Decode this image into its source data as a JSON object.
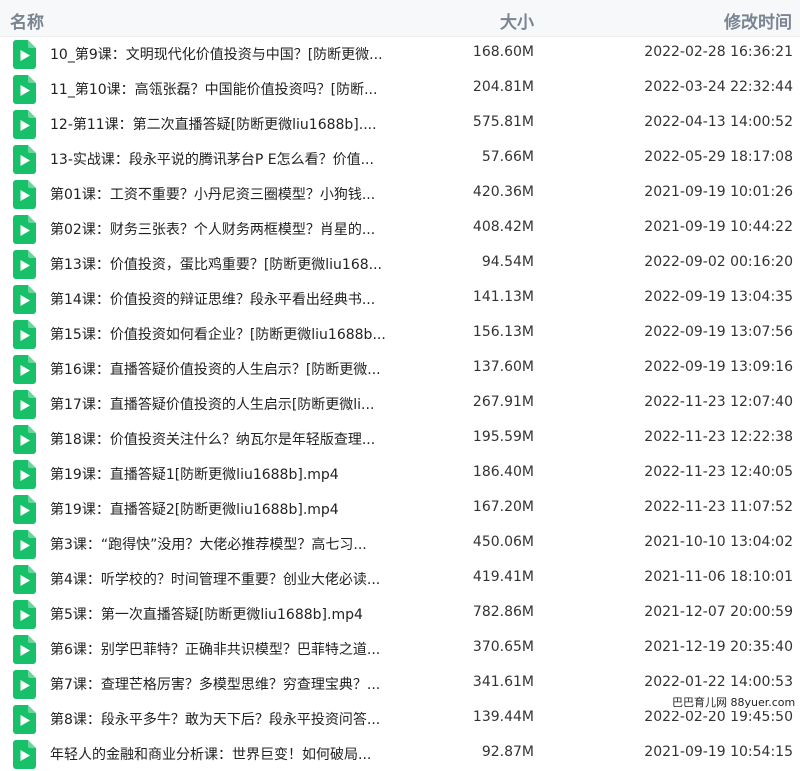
{
  "header": {
    "name": "名称",
    "size": "大小",
    "modified": "修改时间"
  },
  "icon_color": "#19c06a",
  "files": [
    {
      "name": "10_第9课：文明现代化价值投资与中国？[防断更微...",
      "size": "168.60M",
      "modified": "2022-02-28 16:36:21"
    },
    {
      "name": "11_第10课：高瓴张磊？中国能价值投资吗？[防断...",
      "size": "204.81M",
      "modified": "2022-03-24 22:32:44"
    },
    {
      "name": "12-第11课：第二次直播答疑[防断更微liu1688b]....",
      "size": "575.81M",
      "modified": "2022-04-13 14:00:52"
    },
    {
      "name": "13-实战课：段永平说的腾讯茅台P E怎么看？价值...",
      "size": "57.66M",
      "modified": "2022-05-29 18:17:08"
    },
    {
      "name": "第01课：工资不重要？小丹尼资三圈模型？小狗钱...",
      "size": "420.36M",
      "modified": "2021-09-19 10:01:26"
    },
    {
      "name": "第02课：财务三张表？个人财务两框模型？肖星的...",
      "size": "408.42M",
      "modified": "2021-09-19 10:44:22"
    },
    {
      "name": "第13课：价值投资，蛋比鸡重要？[防断更微liu168...",
      "size": "94.54M",
      "modified": "2022-09-02 00:16:20"
    },
    {
      "name": "第14课：价值投资的辩证思维？段永平看出经典书...",
      "size": "141.13M",
      "modified": "2022-09-19 13:04:35"
    },
    {
      "name": "第15课：价值投资如何看企业？[防断更微liu1688b...",
      "size": "156.13M",
      "modified": "2022-09-19 13:07:56"
    },
    {
      "name": "第16课：直播答疑价值投资的人生启示？[防断更微...",
      "size": "137.60M",
      "modified": "2022-09-19 13:09:16"
    },
    {
      "name": "第17课：直播答疑价值投资的人生启示[防断更微li...",
      "size": "267.91M",
      "modified": "2022-11-23 12:07:40"
    },
    {
      "name": "第18课：价值投资关注什么？纳瓦尔是年轻版查理...",
      "size": "195.59M",
      "modified": "2022-11-23 12:22:38"
    },
    {
      "name": "第19课：直播答疑1[防断更微liu1688b].mp4",
      "size": "186.40M",
      "modified": "2022-11-23 12:40:05"
    },
    {
      "name": "第19课：直播答疑2[防断更微liu1688b].mp4",
      "size": "167.20M",
      "modified": "2022-11-23 11:07:52"
    },
    {
      "name": "第3课：“跑得快”没用？大佬必推荐模型？高七习...",
      "size": "450.06M",
      "modified": "2021-10-10 13:04:02"
    },
    {
      "name": "第4课：听学校的？时间管理不重要？创业大佬必读...",
      "size": "419.41M",
      "modified": "2021-11-06 18:10:01"
    },
    {
      "name": "第5课：第一次直播答疑[防断更微liu1688b].mp4",
      "size": "782.86M",
      "modified": "2021-12-07 20:00:59"
    },
    {
      "name": "第6课：别学巴菲特？正确非共识模型？巴菲特之道...",
      "size": "370.65M",
      "modified": "2021-12-19 20:35:40"
    },
    {
      "name": "第7课：查理芒格厉害？多模型思维？穷查理宝典？...",
      "size": "341.61M",
      "modified": "2022-01-22 14:00:53"
    },
    {
      "name": "第8课：段永平多牛？敢为天下后？段永平投资问答...",
      "size": "139.44M",
      "modified": "2022-02-20 19:45:50"
    },
    {
      "name": "年轻人的金融和商业分析课：世界巨变！如何破局...",
      "size": "92.87M",
      "modified": "2021-09-19 10:54:15"
    }
  ],
  "watermark": "巴巴育儿网 88yuer.com"
}
